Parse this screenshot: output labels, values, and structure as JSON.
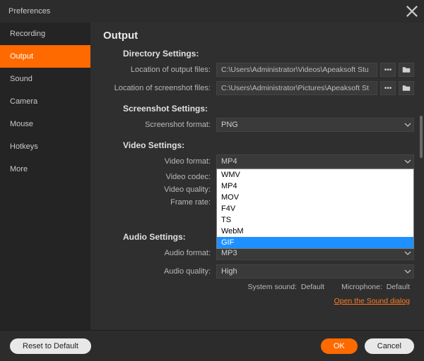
{
  "window": {
    "title": "Preferences"
  },
  "sidebar": {
    "items": [
      {
        "label": "Recording"
      },
      {
        "label": "Output"
      },
      {
        "label": "Sound"
      },
      {
        "label": "Camera"
      },
      {
        "label": "Mouse"
      },
      {
        "label": "Hotkeys"
      },
      {
        "label": "More"
      }
    ],
    "activeIndex": 1
  },
  "page": {
    "title": "Output",
    "sections": {
      "directory": {
        "title": "Directory Settings:",
        "outputLabel": "Location of output files:",
        "outputValue": "C:\\Users\\Administrator\\Videos\\Apeaksoft Stu",
        "screenshotLabel": "Location of screenshot files:",
        "screenshotValue": "C:\\Users\\Administrator\\Pictures\\Apeaksoft St"
      },
      "screenshot": {
        "title": "Screenshot Settings:",
        "formatLabel": "Screenshot format:",
        "formatValue": "PNG"
      },
      "video": {
        "title": "Video Settings:",
        "formatLabel": "Video format:",
        "formatValue": "MP4",
        "codecLabel": "Video codec:",
        "qualityLabel": "Video quality:",
        "frameLabel": "Frame rate:",
        "dropdownOptions": [
          "WMV",
          "MP4",
          "MOV",
          "F4V",
          "TS",
          "WebM",
          "GIF"
        ],
        "dropdownSelected": "GIF"
      },
      "audio": {
        "title": "Audio Settings:",
        "formatLabel": "Audio format:",
        "formatValue": "MP3",
        "qualityLabel": "Audio quality:",
        "qualityValue": "High",
        "systemLabel": "System sound:",
        "systemValue": "Default",
        "micLabel": "Microphone:",
        "micValue": "Default",
        "link": "Open the Sound dialog"
      }
    }
  },
  "footer": {
    "reset": "Reset to Default",
    "ok": "OK",
    "cancel": "Cancel"
  }
}
